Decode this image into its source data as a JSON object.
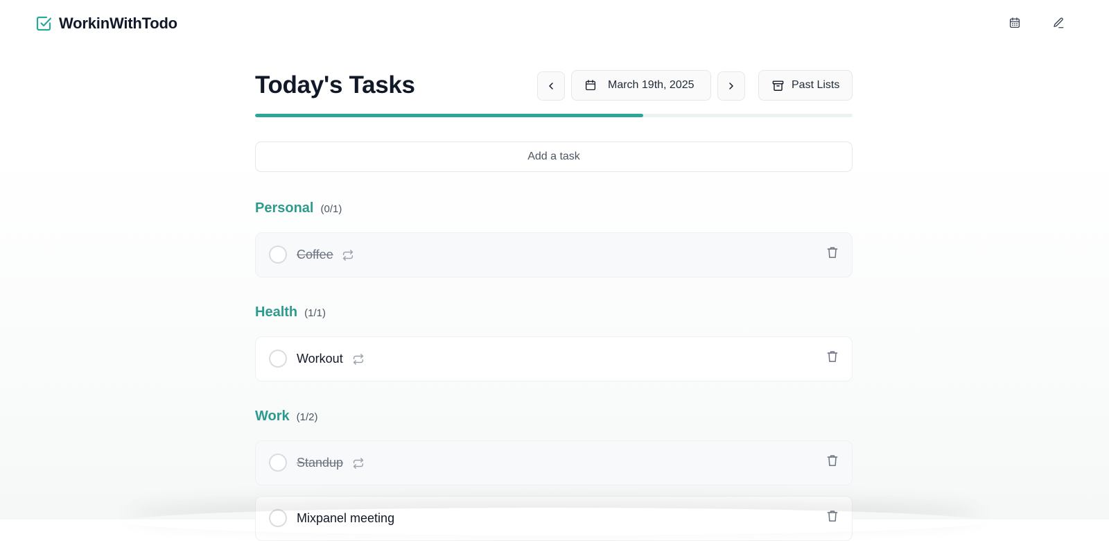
{
  "app": {
    "name": "WorkinWithTodo"
  },
  "header": {
    "title": "Today's Tasks",
    "date_label": "March 19th, 2025",
    "past_lists_label": "Past Lists",
    "progress_fraction": 0.65
  },
  "add_task": {
    "label": "Add a task"
  },
  "sections": [
    {
      "name": "Personal",
      "count": "(0/1)",
      "tasks": [
        {
          "text": "Coffee",
          "done": true,
          "recurring": true
        }
      ]
    },
    {
      "name": "Health",
      "count": "(1/1)",
      "tasks": [
        {
          "text": "Workout",
          "done": false,
          "recurring": true
        }
      ]
    },
    {
      "name": "Work",
      "count": "(1/2)",
      "tasks": [
        {
          "text": "Standup",
          "done": true,
          "recurring": true
        },
        {
          "text": "Mixpanel meeting",
          "done": false,
          "recurring": false
        }
      ]
    }
  ],
  "icons": {
    "brand": "checkbox-icon",
    "top_calendar": "calendar-icon",
    "top_edit": "pencil-icon",
    "prev": "chevron-left-icon",
    "next": "chevron-right-icon",
    "date": "calendar-icon",
    "past": "archive-icon",
    "repeat": "repeat-icon",
    "delete": "trash-icon"
  },
  "colors": {
    "accent": "#2ba79a",
    "section": "#2e9a8e",
    "track": "#eaf3f2"
  }
}
